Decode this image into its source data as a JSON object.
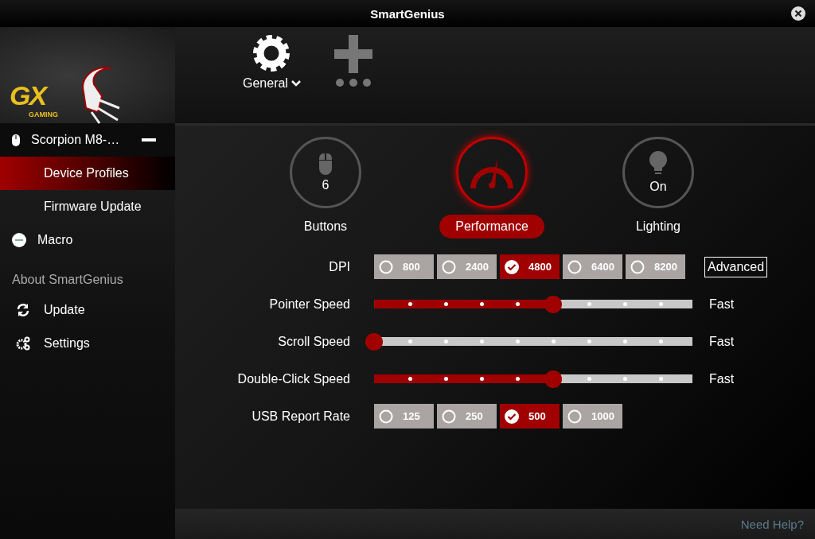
{
  "window": {
    "title": "SmartGenius"
  },
  "logo": {
    "mark": "GX",
    "tagline": "GAMING"
  },
  "top_tabs": [
    {
      "label": "General",
      "kind": "gear",
      "selected": true
    },
    {
      "kind": "add",
      "selected": false
    }
  ],
  "sidebar": {
    "items": [
      {
        "label": "Scorpion M8-…",
        "kind": "device",
        "expanded": true,
        "children": [
          {
            "label": "Device Profiles",
            "selected": true
          },
          {
            "label": "Firmware Update",
            "selected": false
          }
        ]
      },
      {
        "label": "Macro",
        "kind": "macro",
        "selected": false
      }
    ],
    "section_title": "About SmartGenius",
    "links": [
      {
        "label": "Update",
        "kind": "update"
      },
      {
        "label": "Settings",
        "kind": "settings"
      }
    ]
  },
  "modes": [
    {
      "label": "Buttons",
      "value": "6",
      "kind": "mouse",
      "selected": false
    },
    {
      "label": "Performance",
      "kind": "gauge",
      "selected": true
    },
    {
      "label": "Lighting",
      "value": "On",
      "kind": "bulb",
      "selected": false
    }
  ],
  "settings": [
    {
      "label": "DPI",
      "kind": "options",
      "options": [
        {
          "label": "800",
          "selected": false
        },
        {
          "label": "2400",
          "selected": false
        },
        {
          "label": "4800",
          "selected": true
        },
        {
          "label": "6400",
          "selected": false
        },
        {
          "label": "8200",
          "selected": false
        }
      ],
      "extra_button": "Advanced"
    },
    {
      "label": "Pointer Speed",
      "kind": "slider",
      "level": 0.5625,
      "end_label": "Fast"
    },
    {
      "label": "Scroll Speed",
      "kind": "slider",
      "level": 0,
      "end_label": "Fast"
    },
    {
      "label": "Double-Click Speed",
      "kind": "slider",
      "level": 0.5625,
      "end_label": "Fast"
    },
    {
      "label": "USB Report Rate",
      "kind": "options",
      "options": [
        {
          "label": "125",
          "selected": false
        },
        {
          "label": "250",
          "selected": false
        },
        {
          "label": "500",
          "selected": true
        },
        {
          "label": "1000",
          "selected": false
        }
      ]
    }
  ],
  "help_link": "Need Help?"
}
